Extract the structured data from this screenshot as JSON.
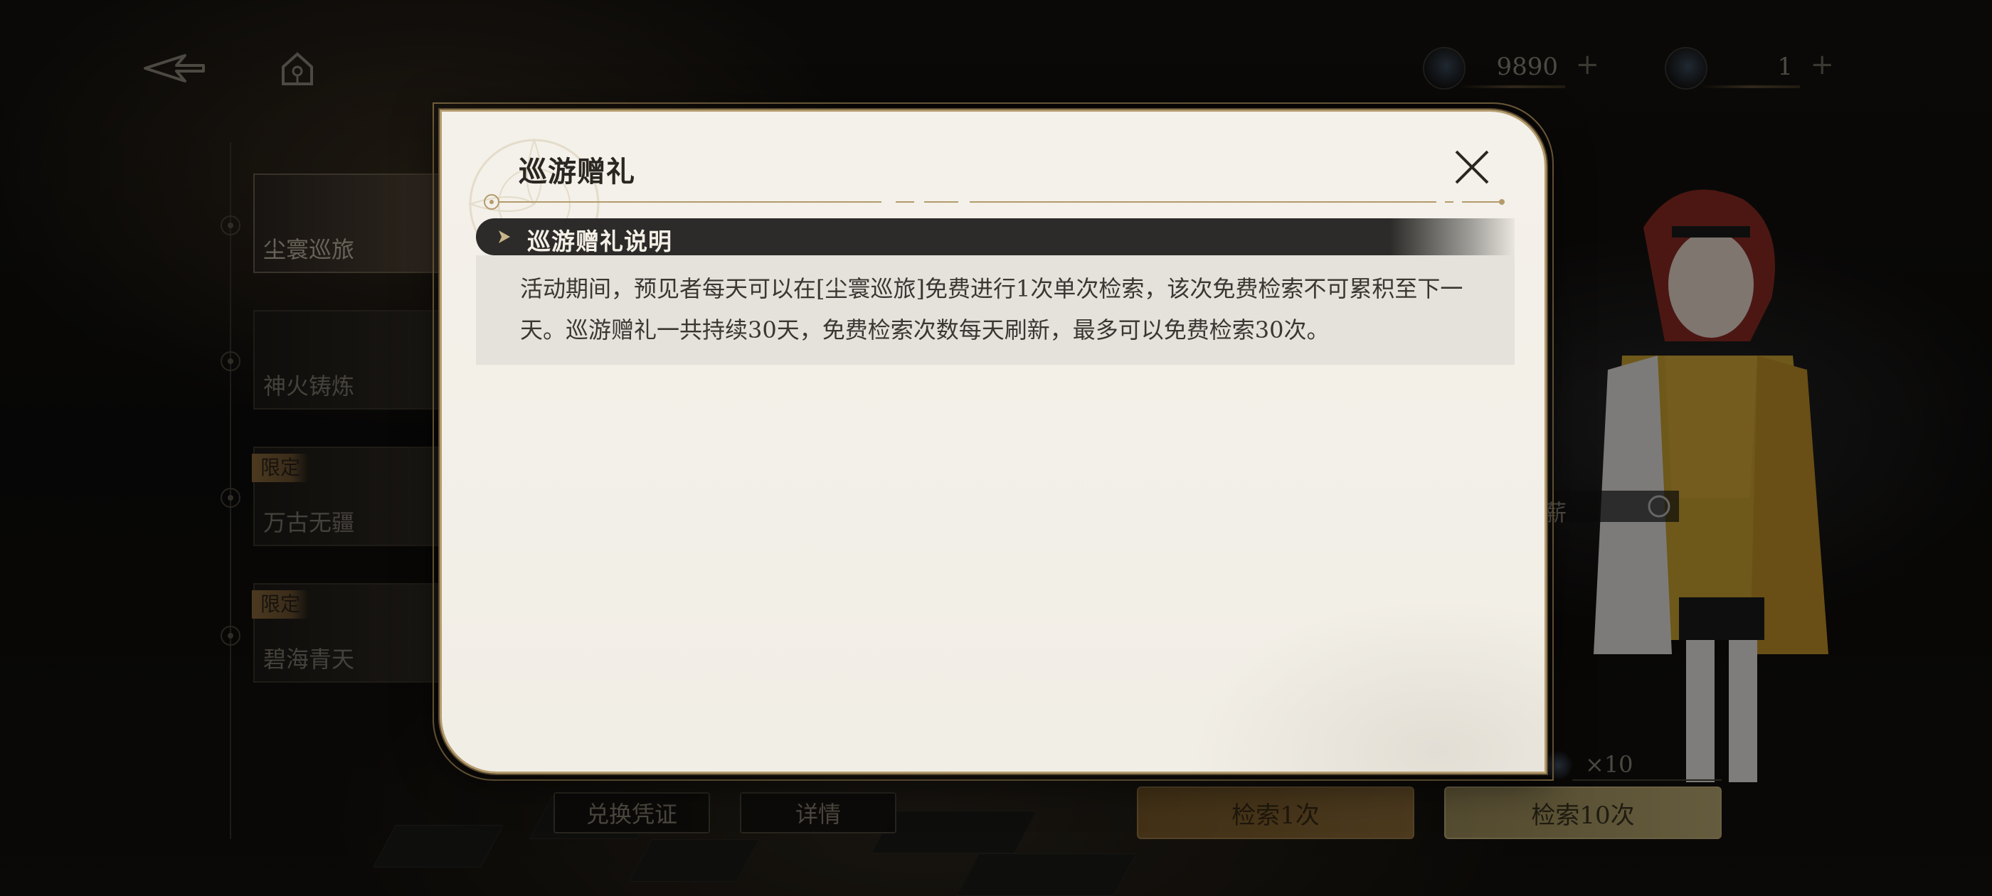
{
  "topbar": {
    "back_icon": "back-arrow-icon",
    "home_icon": "home-icon",
    "currencies": [
      {
        "icon": "gold-key-icon",
        "amount": "9890",
        "plus": "+"
      },
      {
        "icon": "blue-key-icon",
        "amount": "1",
        "plus": "+"
      }
    ]
  },
  "banners": [
    {
      "label": "尘寰巡旅",
      "limited": "",
      "active": true
    },
    {
      "label": "神火铸炼",
      "limited": "",
      "active": false
    },
    {
      "label": "万古无疆",
      "limited": "限定",
      "active": false
    },
    {
      "label": "碧海青天",
      "limited": "限定",
      "active": false
    }
  ],
  "character": {
    "partial_label": "薪"
  },
  "bottom": {
    "exchange_label": "兑换凭证",
    "details_label": "详情",
    "search_one_label": "检索1次",
    "search_ten_label": "检索10次",
    "search_ten_cost": "×10"
  },
  "dialog": {
    "title": "巡游赠礼",
    "section_title": "巡游赠礼说明",
    "section_text": "活动期间，预见者每天可以在[尘寰巡旅]免费进行1次单次检索，该次免费检索不可累积至下一天。巡游赠礼一共持续30天，免费检索次数每天刷新，最多可以免费检索30次。"
  },
  "colors": {
    "dialog_bg": "#f2efe8",
    "dialog_border": "#b39b6c",
    "section_header_bg": "#2c2b29",
    "accent_gold": "#b8a670"
  }
}
